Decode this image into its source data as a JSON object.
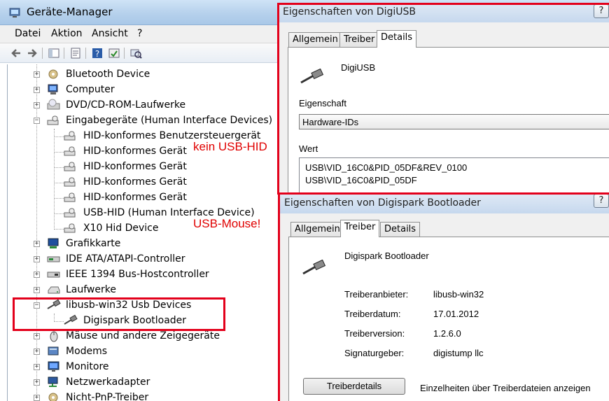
{
  "window": {
    "title": "Geräte-Manager"
  },
  "menu": [
    "Datei",
    "Aktion",
    "Ansicht",
    "?"
  ],
  "toolbar": [
    "back-icon",
    "forward-icon",
    "show-hide-tree-icon",
    "properties-icon",
    "help-icon",
    "update-icon",
    "scan-hardware-icon"
  ],
  "tree": {
    "bluetooth": "Bluetooth Device",
    "computer": "Computer",
    "dvd": "DVD/CD-ROM-Laufwerke",
    "input": "Eingabegeräte (Human Interface Devices)",
    "input_children": [
      "HID-konformes Benutzersteuergerät",
      "HID-konformes Gerät",
      "HID-konformes Gerät",
      "HID-konformes Gerät",
      "HID-konformes Gerät",
      "USB-HID (Human Interface Device)",
      "X10 Hid Device"
    ],
    "graphics": "Grafikkarte",
    "ide": "IDE ATA/ATAPI-Controller",
    "ieee": "IEEE 1394 Bus-Hostcontroller",
    "drives": "Laufwerke",
    "libusb": "libusb-win32 Usb Devices",
    "libusb_child": "Digispark Bootloader",
    "mice": "Mäuse und andere Zeigegeräte",
    "modems": "Modems",
    "monitors": "Monitore",
    "network": "Netzwerkadapter",
    "nonpnp": "Nicht-PnP-Treiber"
  },
  "annotations": {
    "no_hid": "kein USB-HID",
    "mouse": "USB-Mouse!",
    "color": "#e00000"
  },
  "dialog1": {
    "title": "Eigenschaften von DigiUSB",
    "help": "?",
    "tabs": [
      "Allgemein",
      "Treiber",
      "Details"
    ],
    "active_tab": "Details",
    "device_name": "DigiUSB",
    "property_label": "Eigenschaft",
    "property_value": "Hardware-IDs",
    "value_label": "Wert",
    "values": [
      "USB\\VID_16C0&PID_05DF&REV_0100",
      "USB\\VID_16C0&PID_05DF"
    ]
  },
  "dialog2": {
    "title": "Eigenschaften von Digispark Bootloader",
    "help": "?",
    "tabs": [
      "Allgemein",
      "Treiber",
      "Details"
    ],
    "active_tab": "Treiber",
    "device_name": "Digispark Bootloader",
    "fields": [
      {
        "label": "Treiberanbieter:",
        "value": "libusb-win32"
      },
      {
        "label": "Treiberdatum:",
        "value": "17.01.2012"
      },
      {
        "label": "Treiberversion:",
        "value": "1.2.6.0"
      },
      {
        "label": "Signaturgeber:",
        "value": "digistump llc"
      }
    ],
    "details_button": "Treiberdetails",
    "details_desc": "Einzelheiten über Treiberdateien anzeigen"
  },
  "highlight_color": "#e3001b"
}
